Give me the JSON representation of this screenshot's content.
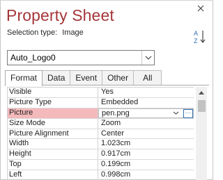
{
  "title": "Property Sheet",
  "selection_type": {
    "label": "Selection type:",
    "value": "Image"
  },
  "object_combo": {
    "value": "Auto_Logo0"
  },
  "tabs": [
    {
      "label": "Format",
      "active": true
    },
    {
      "label": "Data",
      "active": false
    },
    {
      "label": "Event",
      "active": false
    },
    {
      "label": "Other",
      "active": false
    },
    {
      "label": "All",
      "active": false
    }
  ],
  "properties": [
    {
      "name": "Visible",
      "value": "Yes"
    },
    {
      "name": "Picture Type",
      "value": "Embedded"
    },
    {
      "name": "Picture",
      "value": "pen.png",
      "selected": true
    },
    {
      "name": "Size Mode",
      "value": "Zoom"
    },
    {
      "name": "Picture Alignment",
      "value": "Center"
    },
    {
      "name": "Width",
      "value": "1.023cm"
    },
    {
      "name": "Height",
      "value": "0.917cm"
    },
    {
      "name": "Top",
      "value": "0.199cm"
    },
    {
      "name": "Left",
      "value": "0.998cm"
    }
  ],
  "colors": {
    "title": "#a4373a",
    "selected_row": "#f4b9bb",
    "builder_accent": "#2f6fb0"
  },
  "icons": {
    "close": "close-icon",
    "sort": "sort-az-icon",
    "dropdown": "chevron-down-icon",
    "builder": "ellipsis-icon"
  }
}
